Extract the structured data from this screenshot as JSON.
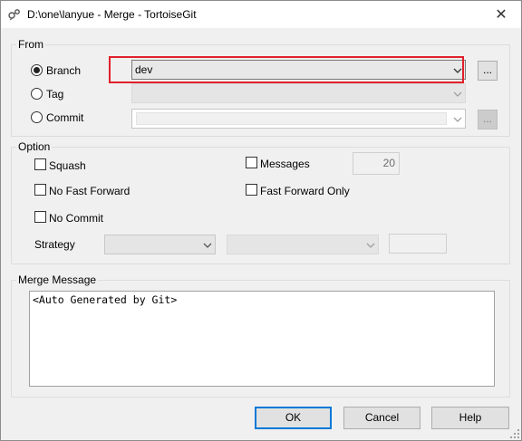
{
  "window": {
    "title": "D:\\one\\lanyue - Merge - TortoiseGit",
    "close_glyph": "✕"
  },
  "from": {
    "legend": "From",
    "branch_label": "Branch",
    "branch_value": "dev",
    "branch_browse": "...",
    "tag_label": "Tag",
    "commit_label": "Commit",
    "commit_browse": "...",
    "selected": "branch"
  },
  "option": {
    "legend": "Option",
    "squash_label": "Squash",
    "no_fast_forward_label": "No Fast Forward",
    "no_commit_label": "No Commit",
    "messages_label": "Messages",
    "messages_count": "20",
    "fast_forward_only_label": "Fast Forward Only",
    "strategy_label": "Strategy"
  },
  "merge_message": {
    "legend": "Merge Message",
    "text": "<Auto Generated by Git>"
  },
  "buttons": {
    "ok": "OK",
    "cancel": "Cancel",
    "help": "Help"
  },
  "colors": {
    "highlight": "#e0202a",
    "default_button_border": "#0078d7"
  }
}
